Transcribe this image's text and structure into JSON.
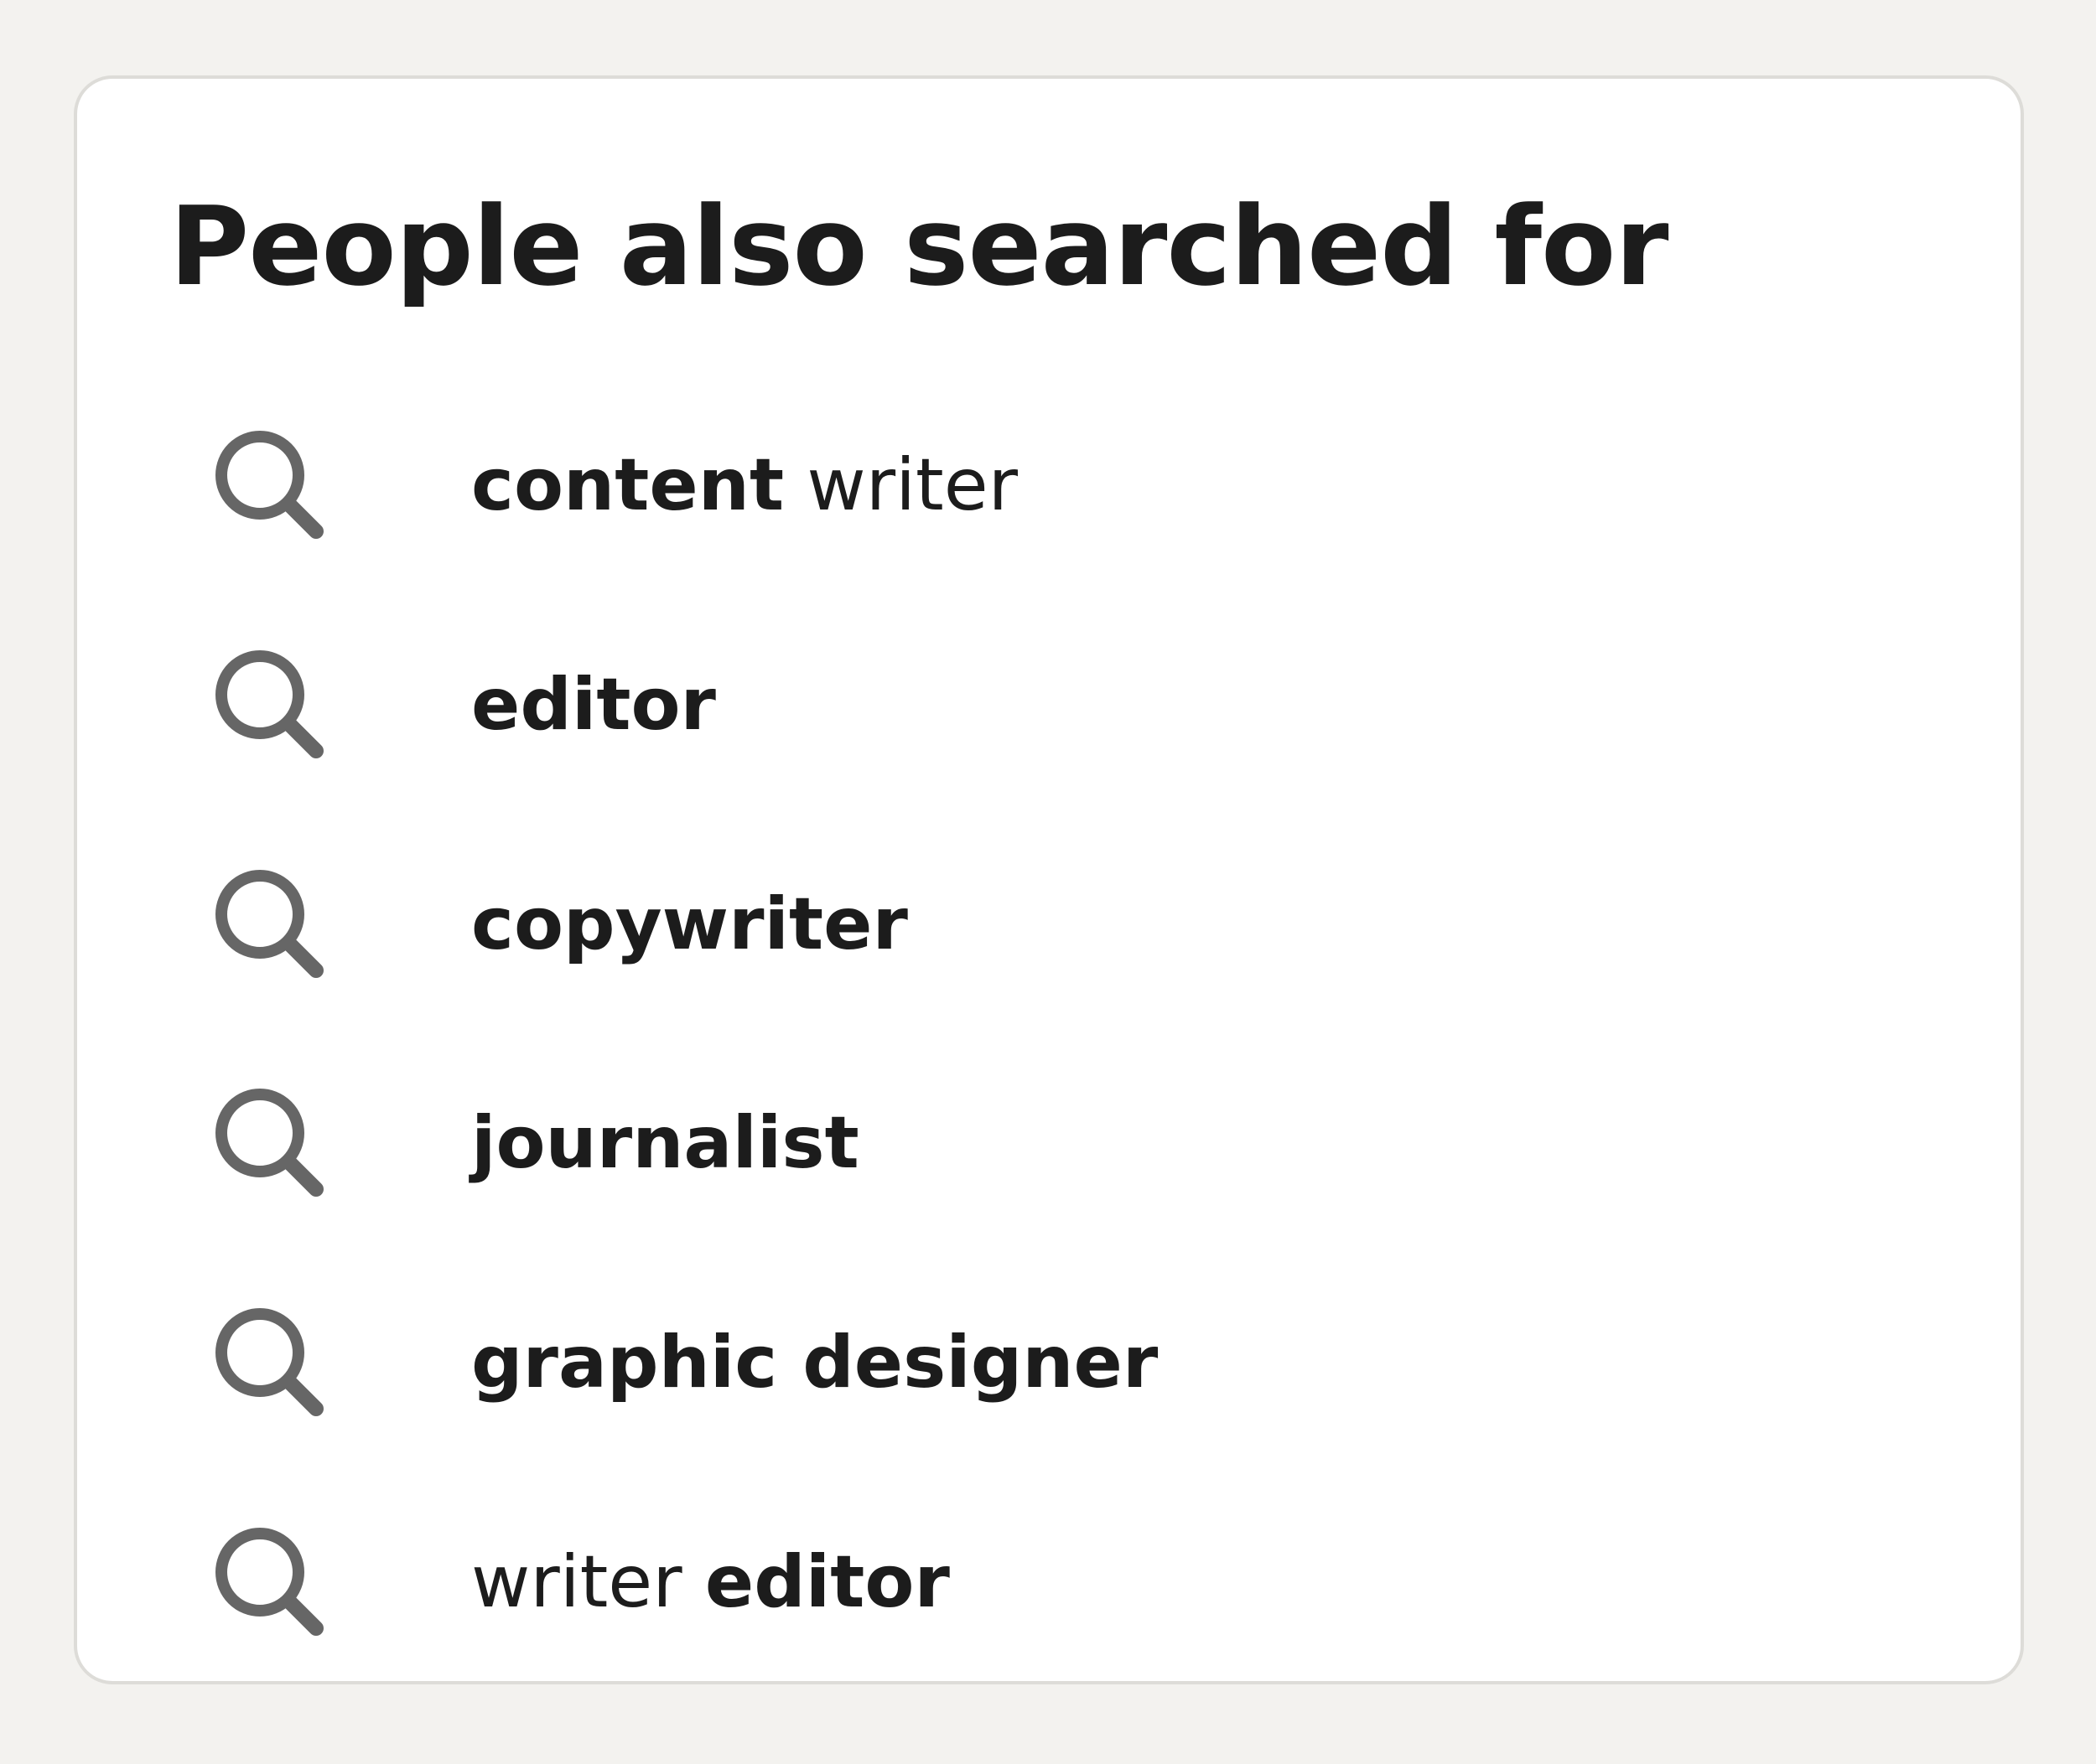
{
  "card": {
    "title": "People also searched for"
  },
  "suggestions": [
    {
      "parts": {
        "a": "content",
        "b": "writer"
      },
      "icon": "search-icon"
    },
    {
      "parts": {
        "a": "editor"
      },
      "icon": "search-icon"
    },
    {
      "parts": {
        "a": "copywriter"
      },
      "icon": "search-icon"
    },
    {
      "parts": {
        "a": "journalist"
      },
      "icon": "search-icon"
    },
    {
      "parts": {
        "a": "graphic designer"
      },
      "icon": "search-icon"
    },
    {
      "parts": {
        "a": "writer",
        "b": "editor"
      },
      "icon": "search-icon"
    }
  ],
  "colors": {
    "background": "#f3f2ef",
    "card": "#ffffff",
    "card_border": "#dddcd8",
    "text": "#1c1c1c",
    "icon": "#666666"
  }
}
